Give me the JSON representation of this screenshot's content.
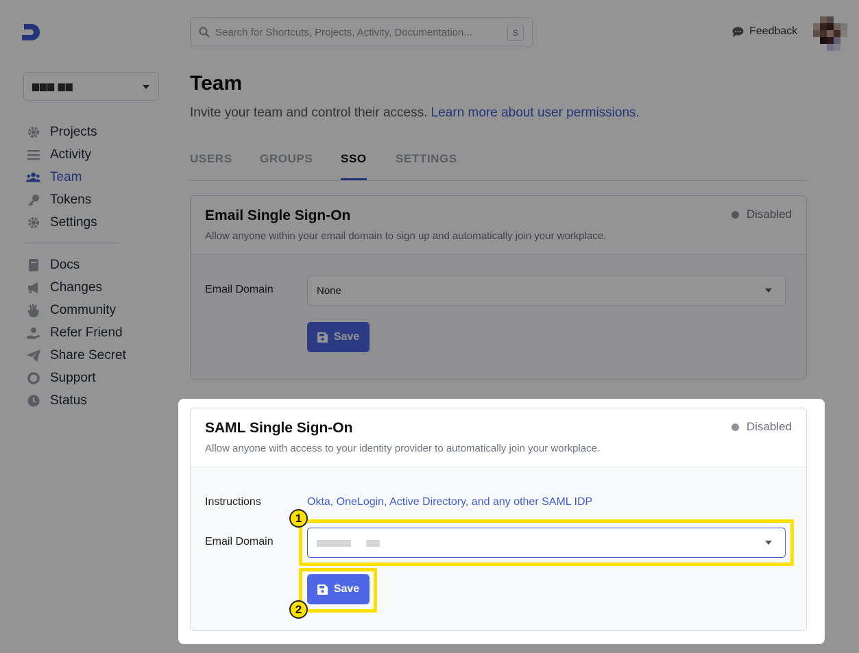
{
  "workspace": {
    "name": "▆▆▆ ▆▆"
  },
  "search": {
    "placeholder": "Search for Shortcuts, Projects, Activity, Documentation...",
    "shortcut": "S"
  },
  "header": {
    "feedback_label": "Feedback"
  },
  "nav": {
    "primary": [
      {
        "label": "Projects",
        "icon": "gear-icon"
      },
      {
        "label": "Activity",
        "icon": "list-icon"
      },
      {
        "label": "Team",
        "icon": "users-icon",
        "active": true
      },
      {
        "label": "Tokens",
        "icon": "key-icon"
      },
      {
        "label": "Settings",
        "icon": "gear-icon"
      }
    ],
    "secondary": [
      {
        "label": "Docs",
        "icon": "book-icon"
      },
      {
        "label": "Changes",
        "icon": "megaphone-icon"
      },
      {
        "label": "Community",
        "icon": "hand-icon"
      },
      {
        "label": "Refer Friend",
        "icon": "gift-hand-icon"
      },
      {
        "label": "Share Secret",
        "icon": "paper-plane-icon"
      },
      {
        "label": "Support",
        "icon": "lifebuoy-icon"
      },
      {
        "label": "Status",
        "icon": "clock-icon"
      }
    ]
  },
  "page": {
    "title": "Team",
    "subtitle": "Invite your team and control their access.",
    "subtitle_link": "Learn more about user permissions."
  },
  "tabs": [
    {
      "label": "USERS"
    },
    {
      "label": "GROUPS"
    },
    {
      "label": "SSO",
      "active": true
    },
    {
      "label": "SETTINGS"
    }
  ],
  "email_sso": {
    "title": "Email Single Sign-On",
    "description": "Allow anyone within your email domain to sign up and automatically join your workplace.",
    "status": "Disabled",
    "domain_label": "Email Domain",
    "domain_value": "None",
    "save_label": "Save"
  },
  "saml_sso": {
    "title": "SAML Single Sign-On",
    "description": "Allow anyone with access to your identity provider to automatically join your workplace.",
    "status": "Disabled",
    "instructions_label": "Instructions",
    "instructions_link": "Okta, OneLogin, Active Directory, and any other SAML IDP",
    "domain_label": "Email Domain",
    "save_label": "Save"
  },
  "annotations": {
    "step1": "1",
    "step2": "2"
  },
  "colors": {
    "accent": "#3d5ad0",
    "button": "#4f67e6",
    "highlight": "#ffe000"
  }
}
